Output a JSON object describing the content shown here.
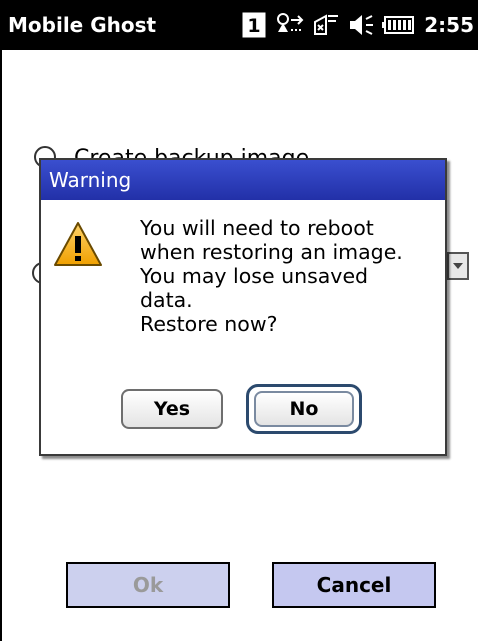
{
  "titlebar": {
    "app_title": "Mobile Ghost",
    "clock": "2:55",
    "icons": [
      "notification-one-icon",
      "connectivity-icon",
      "signal-icon",
      "volume-icon",
      "battery-icon"
    ],
    "notification_badge": "1"
  },
  "background": {
    "radio_label": "Create backup image"
  },
  "dialog": {
    "title": "Warning",
    "icon": "warning-icon",
    "message_lines": [
      "You will need to reboot",
      "when restoring an image.",
      "You may lose unsaved",
      "data.",
      "Restore now?"
    ],
    "yes_label": "Yes",
    "no_label": "No",
    "header_color": "#2a38b8"
  },
  "footer": {
    "ok_label": "Ok",
    "cancel_label": "Cancel",
    "button_color": "#c9ccf0"
  }
}
